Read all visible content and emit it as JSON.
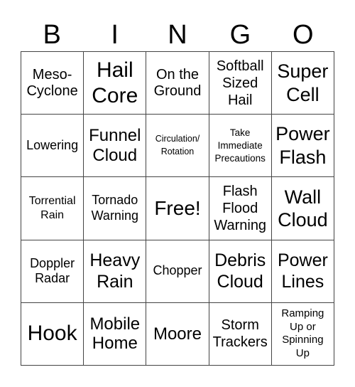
{
  "header": [
    "B",
    "I",
    "N",
    "G",
    "O"
  ],
  "cells": [
    [
      "Meso-\nCyclone",
      "Hail\nCore",
      "On the\nGround",
      "Softball\nSized\nHail",
      "Super\nCell"
    ],
    [
      "Lowering",
      "Funnel\nCloud",
      "Circulation/\nRotation",
      "Take\nImmediate\nPrecautions",
      "Power\nFlash"
    ],
    [
      "Torrential\nRain",
      "Tornado\nWarning",
      "Free!",
      "Flash\nFlood\nWarning",
      "Wall\nCloud"
    ],
    [
      "Doppler\nRadar",
      "Heavy\nRain",
      "Chopper",
      "Debris\nCloud",
      "Power\nLines"
    ],
    [
      "Hook",
      "Mobile\nHome",
      "Moore",
      "Storm\nTrackers",
      "Ramping\nUp or\nSpinning\nUp"
    ]
  ]
}
